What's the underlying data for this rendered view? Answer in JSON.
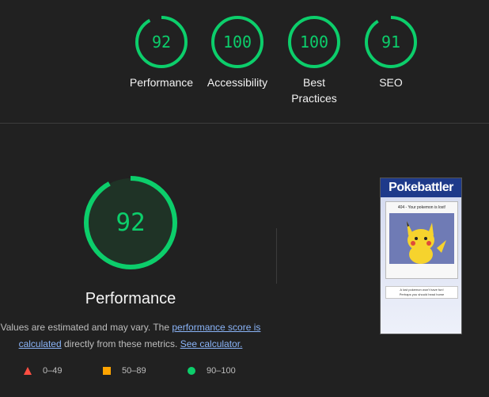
{
  "categories": [
    {
      "id": "performance",
      "score": "92",
      "label": "Performance",
      "value": 92
    },
    {
      "id": "accessibility",
      "score": "100",
      "label": "Accessibility",
      "value": 100
    },
    {
      "id": "best-practices",
      "score": "100",
      "label": "Best\nPractices",
      "value": 100
    },
    {
      "id": "seo",
      "score": "91",
      "label": "SEO",
      "value": 91
    }
  ],
  "main": {
    "score": "92",
    "score_value": 92,
    "title": "Performance",
    "desc_prefix": "Values are estimated and may vary. The ",
    "perf_link": "performance score is calculated",
    "desc_middle": " directly from these metrics. ",
    "calc_link": "See calculator."
  },
  "legend": [
    {
      "range": "0–49",
      "shape": "triangle",
      "color": "#ff4e42"
    },
    {
      "range": "50–89",
      "shape": "square",
      "color": "#ffa400"
    },
    {
      "range": "90–100",
      "shape": "circle",
      "color": "#0cce6b"
    }
  ],
  "thumbnail": {
    "brand": "Pokebattler",
    "card_title": "404 - Your pokemon is lost!",
    "message_line1": "A lost pokemon won't have fun!",
    "message_line2": "Perhaps you should head home"
  },
  "colors": {
    "pass": "#0cce6b",
    "average": "#ffa400",
    "fail": "#ff4e42",
    "background": "#212121"
  }
}
